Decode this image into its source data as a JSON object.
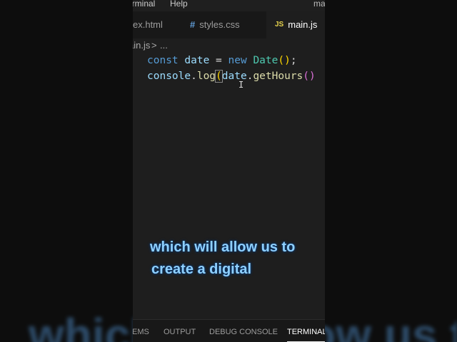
{
  "menubar": {
    "terminal": "erminal",
    "help": "Help",
    "window_title": "ma"
  },
  "tabs": [
    {
      "label": "ex.html",
      "icon": "html-file-icon"
    },
    {
      "label": "styles.css",
      "icon": "#"
    },
    {
      "label": "main.js",
      "icon": "JS"
    }
  ],
  "breadcrumb": {
    "file": "ain.js",
    "separator": ">",
    "more": "..."
  },
  "code": {
    "line1": {
      "kw_const": "const",
      "var_date": "date",
      "op_eq": "=",
      "kw_new": "new",
      "cls_date": "Date",
      "parens": "()",
      "semi": ";"
    },
    "line2": {
      "var_console": "console",
      "dot1": ".",
      "fn_log": "log",
      "paren_open": "(",
      "var_date": "date",
      "dot2": ".",
      "fn_gethours": "getHours",
      "parens": "()"
    }
  },
  "caption": {
    "line1": "which will allow us to",
    "line2": "create a digital",
    "background_text": "which will allow us to"
  },
  "panel": {
    "tabs": [
      "EMS",
      "OUTPUT",
      "DEBUG CONSOLE",
      "TERMINAL"
    ],
    "active": "TERMINAL"
  },
  "colors": {
    "editor_bg": "#1e1e1e",
    "keyword": "#569cd6",
    "variable": "#9cdcfe",
    "function": "#dcdcaa",
    "class": "#4ec9b0",
    "caption": "#8fd0ff"
  }
}
